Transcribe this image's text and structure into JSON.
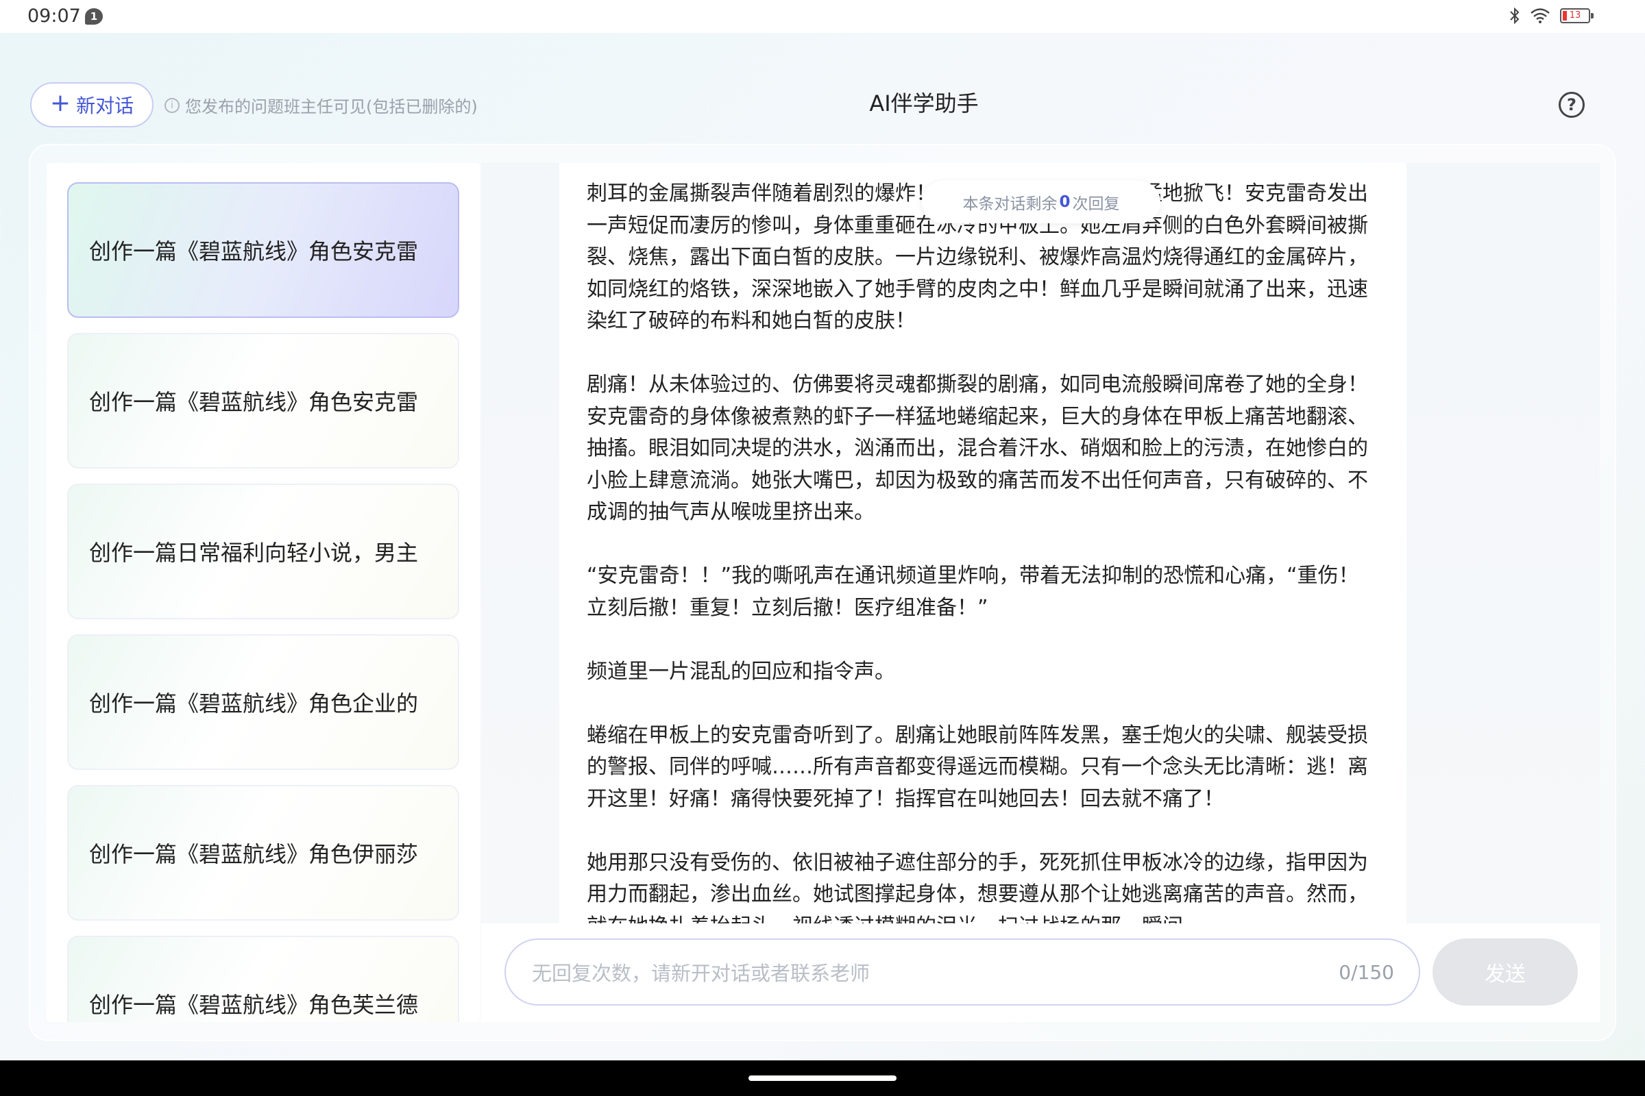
{
  "status_bar": {
    "time": "09:07",
    "notification_count": "1",
    "battery": "13",
    "icons": [
      "bluetooth-icon",
      "wifi-icon",
      "battery-icon"
    ]
  },
  "header": {
    "new_chat_label": "新对话",
    "notice": "您发布的问题班主任可见(包括已删除的)",
    "title": "AI伴学助手",
    "help_label": "?"
  },
  "sidebar": {
    "items": [
      {
        "label": "创作一篇《碧蓝航线》角色安克雷",
        "active": true
      },
      {
        "label": "创作一篇《碧蓝航线》角色安克雷",
        "active": false
      },
      {
        "label": "创作一篇日常福利向轻小说，男主",
        "active": false
      },
      {
        "label": "创作一篇《碧蓝航线》角色企业的",
        "active": false
      },
      {
        "label": "创作一篇《碧蓝航线》角色伊丽莎",
        "active": false
      },
      {
        "label": "创作一篇《碧蓝航线》角色芙兰德",
        "active": false
      }
    ]
  },
  "chat": {
    "remaining_prefix": "本条对话剩余",
    "remaining_count": "0",
    "remaining_suffix": "次回复",
    "paragraphs": [
      "刺耳的金属撕裂声伴随着剧烈的爆炸！安克雷奇的身影被气浪猛地掀飞！安克雷奇发出一声短促而凄厉的惨叫，身体重重砸在冰冷的甲板上。她左肩弃侧的白色外套瞬间被撕裂、烧焦，露出下面白皙的皮肤。一片边缘锐利、被爆炸高温灼烧得通红的金属碎片，如同烧红的烙铁，深深地嵌入了她手臂的皮肉之中！鲜血几乎是瞬间就涌了出来，迅速染红了破碎的布料和她白皙的皮肤！",
      "剧痛！从未体验过的、仿佛要将灵魂都撕裂的剧痛，如同电流般瞬间席卷了她的全身！安克雷奇的身体像被煮熟的虾子一样猛地蜷缩起来，巨大的身体在甲板上痛苦地翻滚、抽搐。眼泪如同决堤的洪水，汹涌而出，混合着汗水、硝烟和脸上的污渍，在她惨白的小脸上肆意流淌。她张大嘴巴，却因为极致的痛苦而发不出任何声音，只有破碎的、不成调的抽气声从喉咙里挤出来。",
      "“安克雷奇！！”我的嘶吼声在通讯频道里炸响，带着无法抑制的恐慌和心痛，“重伤！立刻后撤！重复！立刻后撤！医疗组准备！”",
      "频道里一片混乱的回应和指令声。",
      "蜷缩在甲板上的安克雷奇听到了。剧痛让她眼前阵阵发黑，塞壬炮火的尖啸、舰装受损的警报、同伴的呼喊……所有声音都变得遥远而模糊。只有一个念头无比清晰：逃！离开这里！好痛！痛得快要死掉了！指挥官在叫她回去！回去就不痛了！",
      "她用那只没有受伤的、依旧被袖子遮住部分的手，死死抓住甲板冰冷的边缘，指甲因为用力而翻起，渗出血丝。她试图撑起身体，想要遵从那个让她逃离痛苦的声音。然而，就在她挣扎着抬起头，视线透过模糊的泪光，扫过战场的那一瞬间"
    ]
  },
  "input": {
    "placeholder": "无回复次数，请新开对话或者联系老师",
    "counter": "0/150",
    "send_label": "发送"
  }
}
